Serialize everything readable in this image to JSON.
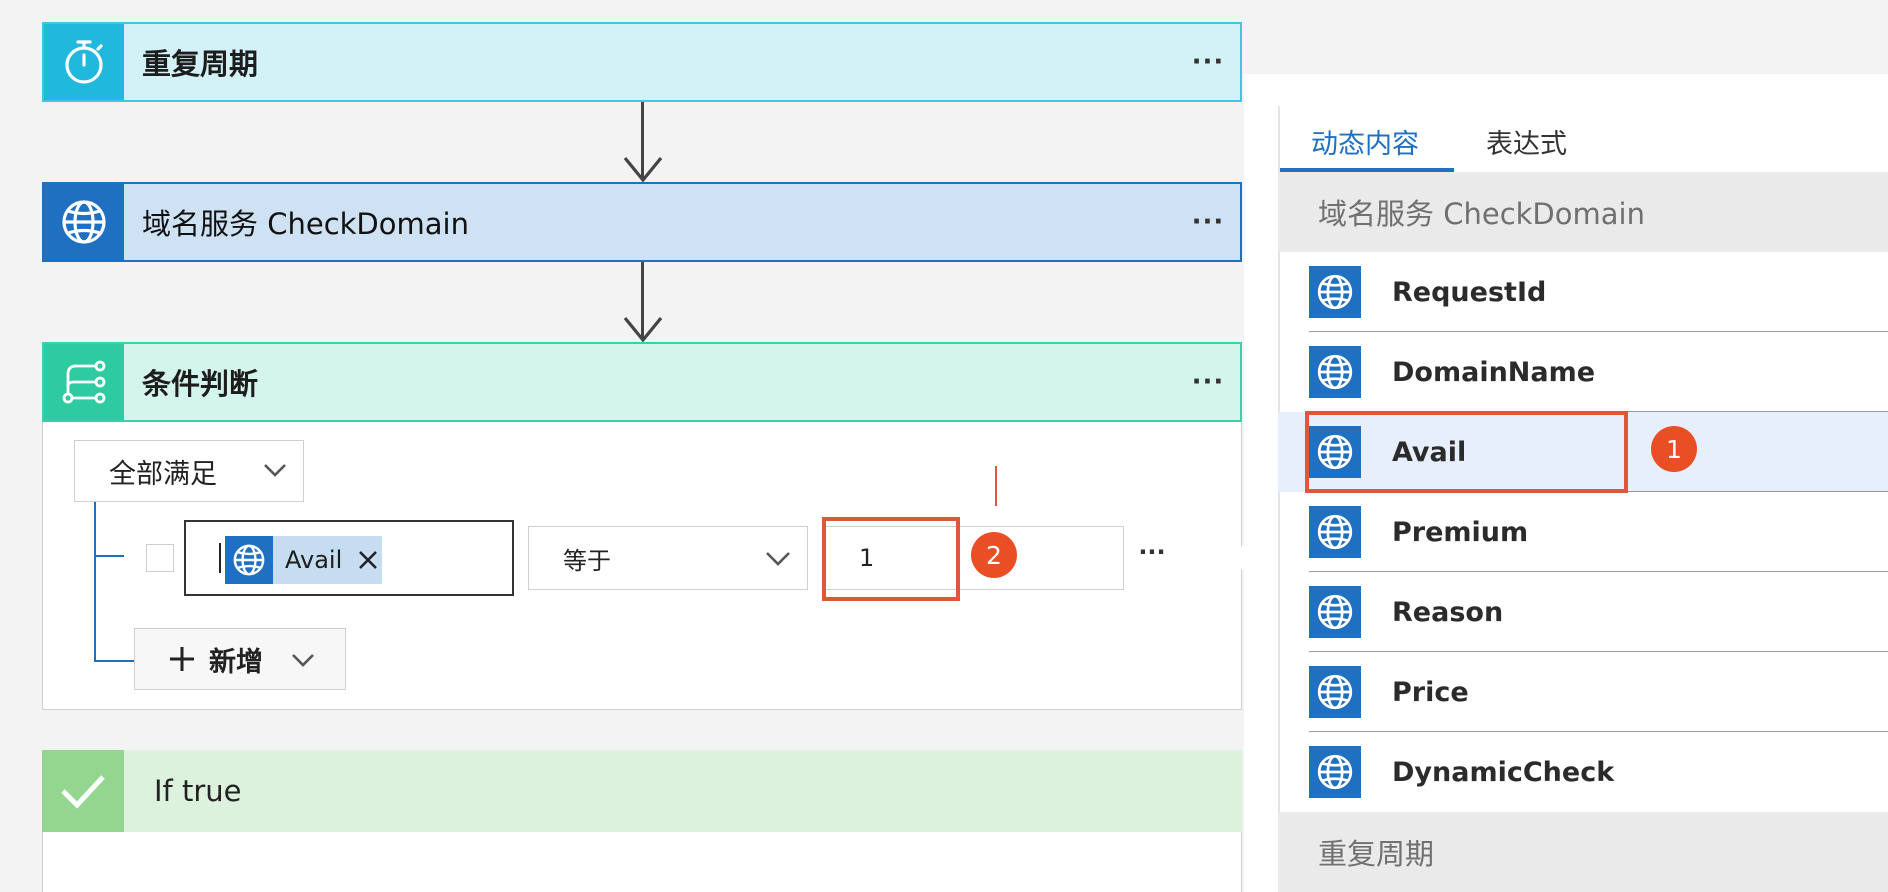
{
  "flow": {
    "recurrence": {
      "title": "重复周期",
      "more": "···"
    },
    "domain_service": {
      "title": "域名服务 CheckDomain",
      "more": "···"
    },
    "condition": {
      "title": "条件判断",
      "more": "···"
    }
  },
  "condition_editor": {
    "match_mode": "全部满足",
    "row": {
      "token_label": "Avail",
      "operator": "等于",
      "value": "1",
      "more": "···"
    },
    "add_label": "新增"
  },
  "if_true": {
    "title": "If true"
  },
  "dynamic_panel": {
    "tabs": [
      "动态内容",
      "表达式"
    ],
    "sections": [
      {
        "header": "域名服务 CheckDomain",
        "items": [
          "RequestId",
          "DomainName",
          "Avail",
          "Premium",
          "Reason",
          "Price",
          "DynamicCheck"
        ]
      },
      {
        "header": "重复周期"
      }
    ],
    "selected_item": "Avail"
  },
  "annotations": {
    "badge_1": "1",
    "badge_2": "2"
  },
  "colors": {
    "accent_blue": "#1f70c1",
    "recurrence_teal": "#21b8de",
    "condition_green": "#2ecba2",
    "if_true_green": "#92d68f",
    "annotation_red": "#ea4e24"
  }
}
